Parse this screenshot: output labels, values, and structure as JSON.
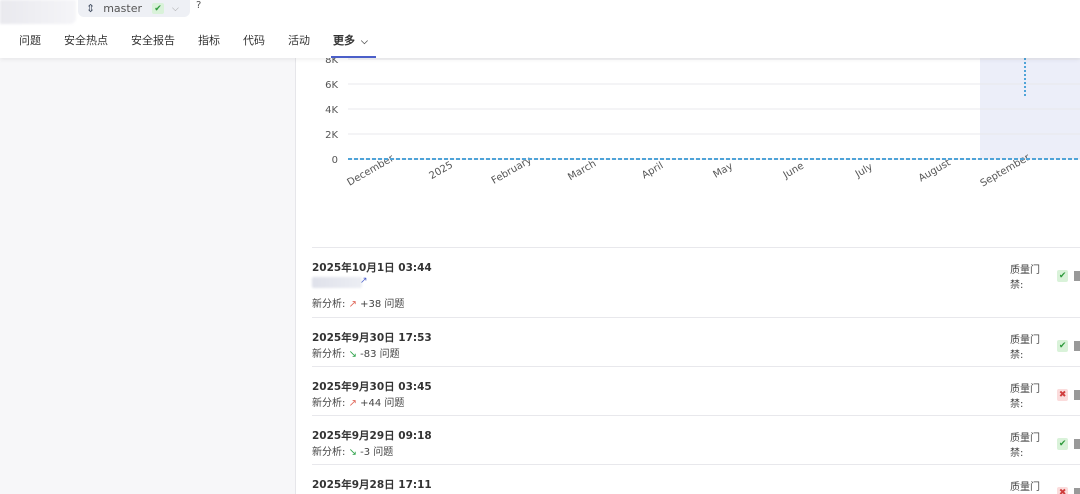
{
  "header": {
    "branch": "master",
    "branch_status": "✔",
    "help": "?"
  },
  "nav": [
    {
      "label": "问题"
    },
    {
      "label": "安全热点"
    },
    {
      "label": "安全报告"
    },
    {
      "label": "指标"
    },
    {
      "label": "代码"
    },
    {
      "label": "活动"
    },
    {
      "label": "更多"
    }
  ],
  "chart_data": {
    "type": "line",
    "y_ticks": [
      "8K",
      "6K",
      "4K",
      "2K",
      "0"
    ],
    "x_ticks": [
      "December",
      "2025",
      "February",
      "March",
      "April",
      "May",
      "June",
      "July",
      "August",
      "September"
    ],
    "ylim": [
      0,
      8000
    ],
    "series": [
      {
        "values": [
          0,
          0,
          0,
          0,
          0,
          0,
          0,
          0,
          0,
          0
        ]
      }
    ],
    "colors": {
      "line": "#4fa3d8",
      "highlight": "#eceef9",
      "grid": "#e8e8ec"
    }
  },
  "gate_label": "质量门禁:",
  "analysis_prefix": "新分析:",
  "analyses": [
    {
      "date": "2025年10月1日 03:44",
      "dir": "up",
      "arrow": "↗",
      "delta": "+38 问题",
      "gate": "pass",
      "gate_icon": "✔",
      "has_version": true
    },
    {
      "date": "2025年9月30日 17:53",
      "dir": "down",
      "arrow": "↘",
      "delta": "-83 问题",
      "gate": "pass",
      "gate_icon": "✔",
      "has_version": false
    },
    {
      "date": "2025年9月30日 03:45",
      "dir": "up",
      "arrow": "↗",
      "delta": "+44 问题",
      "gate": "fail",
      "gate_icon": "✖",
      "has_version": false
    },
    {
      "date": "2025年9月29日 09:18",
      "dir": "down",
      "arrow": "↘",
      "delta": "-3 问题",
      "gate": "pass",
      "gate_icon": "✔",
      "has_version": false
    },
    {
      "date": "2025年9月28日 17:11",
      "dir": "down",
      "arrow": "↘",
      "delta": "",
      "gate": "fail",
      "gate_icon": "✖",
      "has_version": false
    }
  ]
}
